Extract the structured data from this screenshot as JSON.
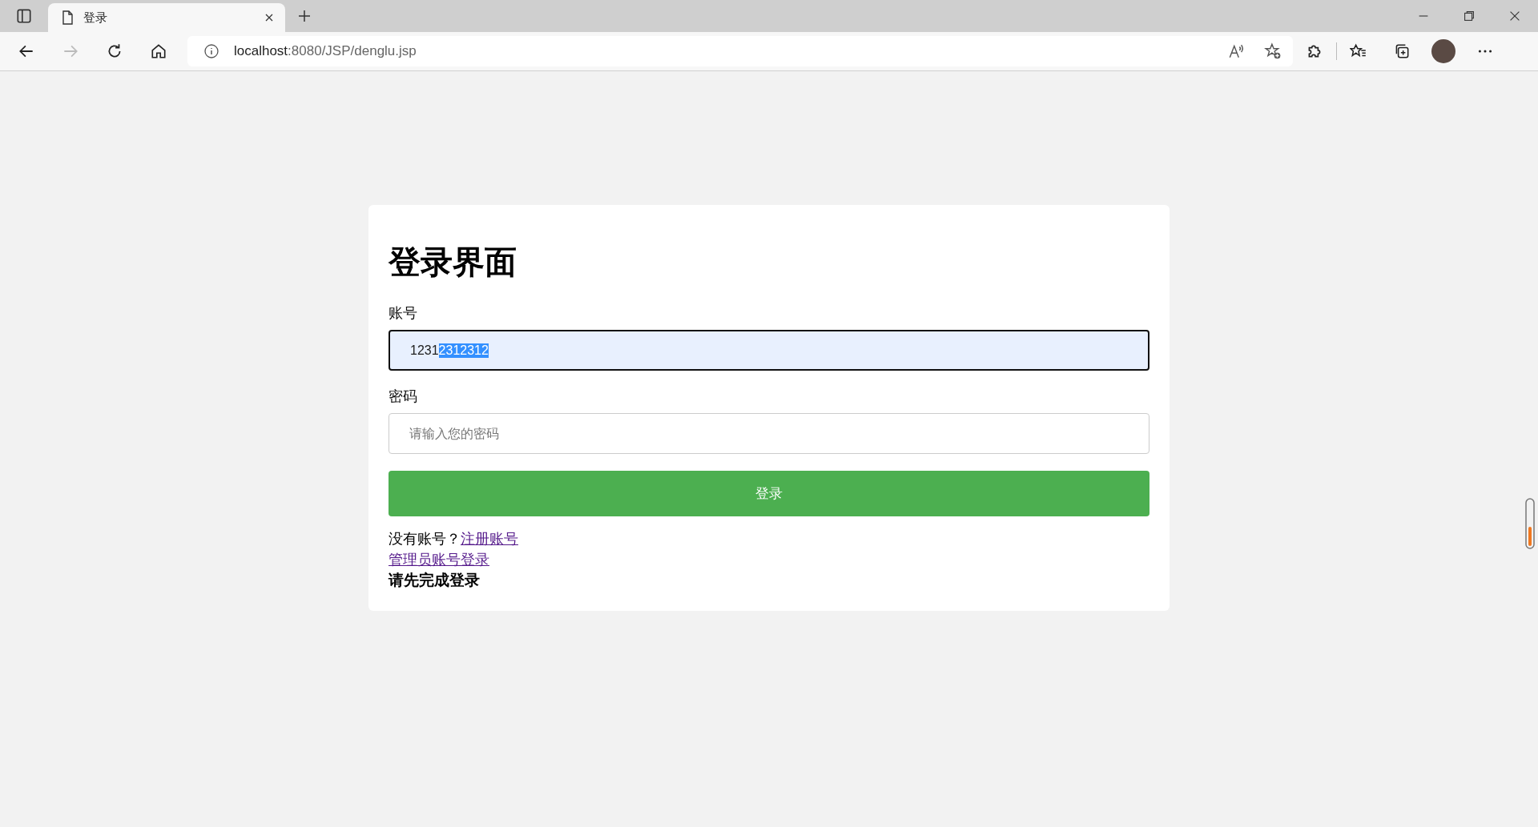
{
  "browser": {
    "tab": {
      "title": "登录",
      "selected": true
    },
    "address": {
      "host": "localhost",
      "path": ":8080/JSP/denglu.jsp"
    }
  },
  "form": {
    "title": "登录界面",
    "fields": [
      {
        "label": "账号",
        "kind": "filled",
        "focused": true,
        "value_plain": "1231",
        "value_selected": "2312312"
      },
      {
        "label": "密码",
        "kind": "empty",
        "focused": false,
        "placeholder": "请输入您的密码"
      }
    ],
    "submit": "登录",
    "register_prompt": "没有账号？",
    "register_link": "注册账号",
    "admin_link": "管理员账号登录",
    "message": "请先完成登录"
  }
}
